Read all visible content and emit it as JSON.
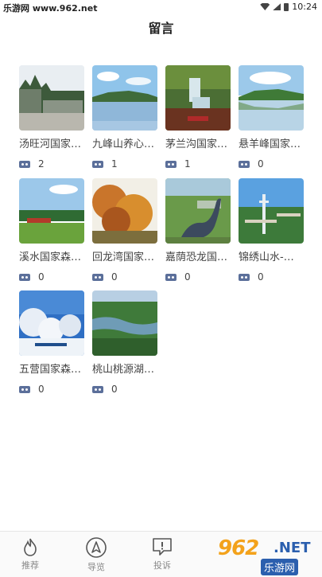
{
  "status_bar": {
    "site": "乐游网 www.962.net",
    "time": "10:24"
  },
  "header": {
    "title": "留言"
  },
  "cards": [
    {
      "title": "汤旺河国家…",
      "count": "2"
    },
    {
      "title": "九峰山养心…",
      "count": "1"
    },
    {
      "title": "茅兰沟国家…",
      "count": "1"
    },
    {
      "title": "悬羊峰国家…",
      "count": "0"
    },
    {
      "title": "溪水国家森…",
      "count": "0"
    },
    {
      "title": "回龙湾国家…",
      "count": "0"
    },
    {
      "title": "嘉荫恐龙国…",
      "count": "0"
    },
    {
      "title": "锦绣山水-…",
      "count": "0"
    },
    {
      "title": "五营国家森…",
      "count": "0"
    },
    {
      "title": "桃山桃源湖…",
      "count": "0"
    }
  ],
  "tabbar": {
    "items": [
      {
        "label": "推荐",
        "icon": "fire-icon"
      },
      {
        "label": "导览",
        "icon": "navigation-icon"
      },
      {
        "label": "投诉",
        "icon": "complaint-icon"
      }
    ]
  },
  "watermark": {
    "logo": "962",
    "net": ".NET",
    "sub": "乐游网"
  },
  "colors": {
    "accent": "#5b6f9a",
    "text": "#444444"
  }
}
